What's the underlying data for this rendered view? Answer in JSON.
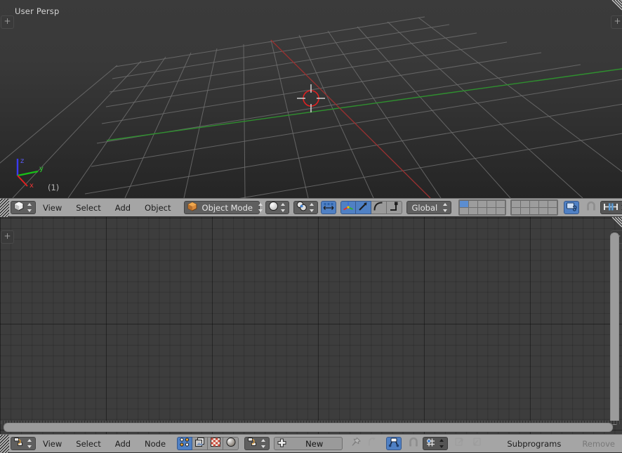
{
  "viewport": {
    "perspective_label": "User Persp",
    "object_count_label": "(1)",
    "axis_x": "x",
    "axis_y": "y",
    "axis_z": "z",
    "region_toggle": "+",
    "colors": {
      "bg_top": "#3b3b3b",
      "bg_bottom": "#252525",
      "grid_line": "#5a5a5a",
      "axis_x_color": "#9b2b2b",
      "axis_y_color": "#2e8a2e",
      "cursor_color": "#e03030"
    }
  },
  "header_3d": {
    "editor_type_icon": "object-3d-view-icon",
    "menus": [
      {
        "name": "view",
        "label": "View"
      },
      {
        "name": "select",
        "label": "Select"
      },
      {
        "name": "add",
        "label": "Add"
      },
      {
        "name": "object",
        "label": "Object"
      }
    ],
    "mode_selector": {
      "label": "Object Mode",
      "icon": "object-mode-cube-icon"
    },
    "shading_selector": {
      "icon": "solid-shading-sphere-icon"
    },
    "pivot_selector": {
      "icon": "pivot-median-point-icon"
    },
    "manipulator_toggle": {
      "icon": "manipulator-widget-icon"
    },
    "transform_icons": [
      {
        "name": "transform-manipulator-icon",
        "active": true
      },
      {
        "name": "translate-arrow-icon",
        "active": true
      },
      {
        "name": "rotate-arc-icon",
        "active": false
      },
      {
        "name": "scale-corner-icon",
        "active": false
      }
    ],
    "orientation_selector": {
      "label": "Global"
    },
    "layers": {
      "group_a": [
        1,
        0,
        0,
        0,
        0,
        0,
        0,
        0,
        0,
        0
      ],
      "group_b": [
        0,
        0,
        0,
        0,
        0,
        0,
        0,
        0,
        0,
        0
      ]
    },
    "lock_scene_icon": "lock-scene-to-object-icon",
    "snap_magnet_icon": "snap-magnet-icon",
    "snap_element_selector": {
      "icon": "snap-increment-icon"
    },
    "proportional_edit_icon": "proportional-edit-icon",
    "render_icons": [
      {
        "name": "render-image-icon"
      },
      {
        "name": "render-animation-icon"
      }
    ]
  },
  "node_editor": {
    "grid_color": "#3d3d3d",
    "region_toggle": "+"
  },
  "header_node": {
    "editor_type_icon": "node-editor-icon",
    "menus": [
      {
        "name": "view",
        "label": "View"
      },
      {
        "name": "select",
        "label": "Select"
      },
      {
        "name": "add",
        "label": "Add"
      },
      {
        "name": "node",
        "label": "Node"
      }
    ],
    "shader_type_icons": [
      {
        "name": "shader-nodes-icon",
        "active": true
      },
      {
        "name": "compositing-nodes-icon",
        "active": false
      },
      {
        "name": "texture-nodes-icon",
        "active": false
      },
      {
        "name": "material-sphere-icon",
        "active": false
      }
    ],
    "datablock_selector": {
      "icon": "node-tree-datablock-icon"
    },
    "new_button": {
      "label": "New",
      "icon": "plus-icon"
    },
    "pin_icon": "pin-icon",
    "go_to_parent_icon": "go-to-parent-node-icon",
    "use_nodes_icon": "use-nodes-icon",
    "snap_magnet_icon": "snap-magnet-icon",
    "snap_node_selector": {
      "icon": "snap-node-grid-icon"
    },
    "copy_icon": "copy-to-clipboard-icon",
    "paste_icon": "paste-from-clipboard-icon",
    "subprograms_label": "Subprograms",
    "remove_label": "Remove"
  }
}
